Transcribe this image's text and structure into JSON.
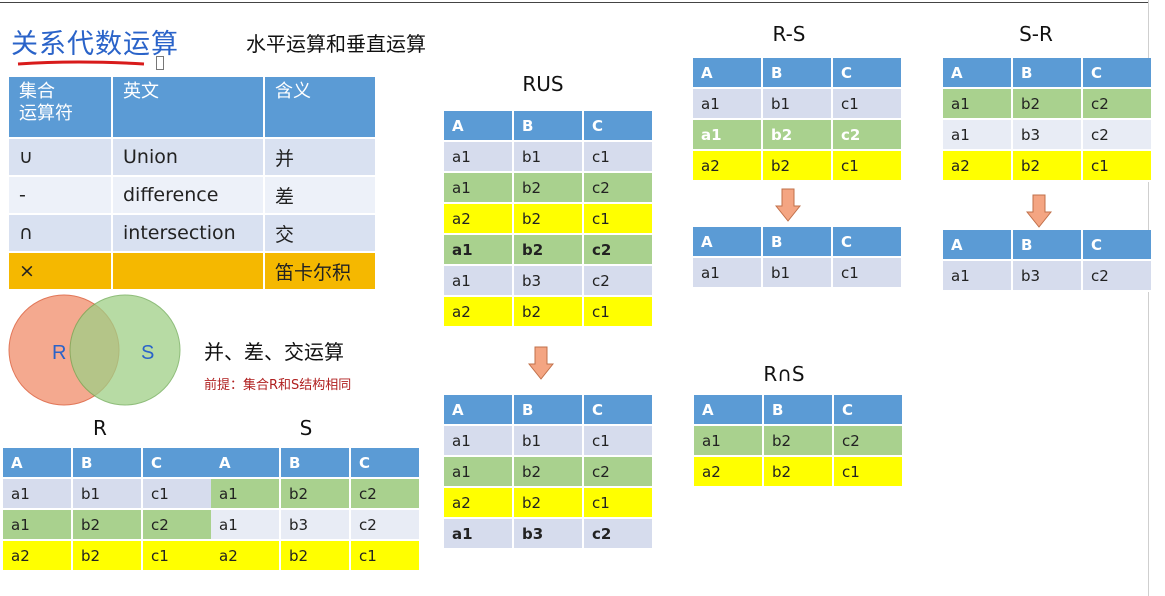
{
  "title": "关系代数运算",
  "subtitle": "水平运算和垂直运算",
  "operators_table": {
    "headers": [
      "集合\n运算符",
      "英文",
      "含义"
    ],
    "rows": [
      {
        "symbol": "∪",
        "english": "Union",
        "meaning": "并"
      },
      {
        "symbol": "-",
        "english": "difference",
        "meaning": "差"
      },
      {
        "symbol": "∩",
        "english": "intersection",
        "meaning": "交"
      },
      {
        "symbol": "×",
        "english": "",
        "meaning": "笛卡尔积"
      }
    ]
  },
  "venn": {
    "left_label": "R",
    "right_label": "S",
    "left_color": "#f4a58a",
    "right_color": "#9fcf86"
  },
  "operations_caption": "并、差、交运算",
  "premise": "前提：集合R和S结构相同",
  "colors": {
    "header": "#5b9bd5",
    "row_blue": "#d6dced",
    "row_green": "#a9d18e",
    "row_yellow": "#ffff00",
    "arrow": "#f4a582"
  },
  "tables": {
    "R": {
      "label": "R",
      "columns": [
        "A",
        "B",
        "C"
      ],
      "rows": [
        [
          "a1",
          "b1",
          "c1"
        ],
        [
          "a1",
          "b2",
          "c2"
        ],
        [
          "a2",
          "b2",
          "c1"
        ]
      ]
    },
    "S": {
      "label": "S",
      "columns": [
        "A",
        "B",
        "C"
      ],
      "rows": [
        [
          "a1",
          "b2",
          "c2"
        ],
        [
          "a1",
          "b3",
          "c2"
        ],
        [
          "a2",
          "b2",
          "c1"
        ]
      ]
    },
    "union_before": {
      "label": "RUS",
      "columns": [
        "A",
        "B",
        "C"
      ],
      "rows": [
        [
          "a1",
          "b1",
          "c1"
        ],
        [
          "a1",
          "b2",
          "c2"
        ],
        [
          "a2",
          "b2",
          "c1"
        ],
        [
          "a1",
          "b2",
          "c2"
        ],
        [
          "a1",
          "b3",
          "c2"
        ],
        [
          "a2",
          "b2",
          "c1"
        ]
      ]
    },
    "union_after": {
      "columns": [
        "A",
        "B",
        "C"
      ],
      "rows": [
        [
          "a1",
          "b1",
          "c1"
        ],
        [
          "a1",
          "b2",
          "c2"
        ],
        [
          "a2",
          "b2",
          "c1"
        ],
        [
          "a1",
          "b3",
          "c2"
        ]
      ]
    },
    "r_minus_s_before": {
      "label": "R-S",
      "columns": [
        "A",
        "B",
        "C"
      ],
      "rows": [
        [
          "a1",
          "b1",
          "c1"
        ],
        [
          "a1",
          "b2",
          "c2"
        ],
        [
          "a2",
          "b2",
          "c1"
        ]
      ]
    },
    "r_minus_s_after": {
      "columns": [
        "A",
        "B",
        "C"
      ],
      "rows": [
        [
          "a1",
          "b1",
          "c1"
        ]
      ]
    },
    "s_minus_r_before": {
      "label": "S-R",
      "columns": [
        "A",
        "B",
        "C"
      ],
      "rows": [
        [
          "a1",
          "b2",
          "c2"
        ],
        [
          "a1",
          "b3",
          "c2"
        ],
        [
          "a2",
          "b2",
          "c1"
        ]
      ]
    },
    "s_minus_r_after": {
      "columns": [
        "A",
        "B",
        "C"
      ],
      "rows": [
        [
          "a1",
          "b3",
          "c2"
        ]
      ]
    },
    "intersection": {
      "label": "R∩S",
      "columns": [
        "A",
        "B",
        "C"
      ],
      "rows": [
        [
          "a1",
          "b2",
          "c2"
        ],
        [
          "a2",
          "b2",
          "c1"
        ]
      ]
    }
  }
}
